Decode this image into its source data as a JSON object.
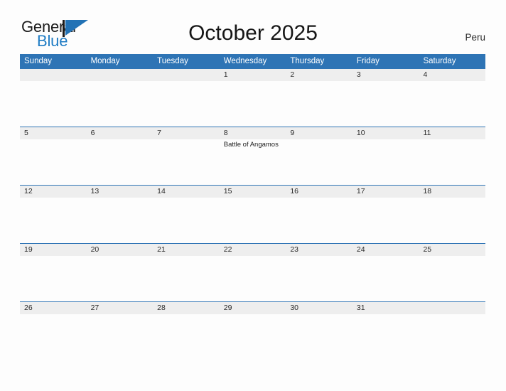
{
  "brand": {
    "name_part1": "General",
    "name_part2": "Blue",
    "triangle_color": "#2272b5",
    "blue_text_color": "#1f7cc4"
  },
  "header": {
    "title": "October 2025",
    "region": "Peru"
  },
  "colors": {
    "header_blue": "#2e74b5",
    "daynum_band": "#eeeeee",
    "page_background": "#fdfdfd",
    "text_dark": "#1b1b1b"
  },
  "calendar": {
    "month": "October",
    "year": "2025",
    "weekday_headers": [
      "Sunday",
      "Monday",
      "Tuesday",
      "Wednesday",
      "Thursday",
      "Friday",
      "Saturday"
    ],
    "weeks": [
      {
        "days": [
          {
            "num": "",
            "events": []
          },
          {
            "num": "",
            "events": []
          },
          {
            "num": "",
            "events": []
          },
          {
            "num": "1",
            "events": []
          },
          {
            "num": "2",
            "events": []
          },
          {
            "num": "3",
            "events": []
          },
          {
            "num": "4",
            "events": []
          }
        ]
      },
      {
        "days": [
          {
            "num": "5",
            "events": []
          },
          {
            "num": "6",
            "events": []
          },
          {
            "num": "7",
            "events": []
          },
          {
            "num": "8",
            "events": [
              "Battle of Angamos"
            ]
          },
          {
            "num": "9",
            "events": []
          },
          {
            "num": "10",
            "events": []
          },
          {
            "num": "11",
            "events": []
          }
        ]
      },
      {
        "days": [
          {
            "num": "12",
            "events": []
          },
          {
            "num": "13",
            "events": []
          },
          {
            "num": "14",
            "events": []
          },
          {
            "num": "15",
            "events": []
          },
          {
            "num": "16",
            "events": []
          },
          {
            "num": "17",
            "events": []
          },
          {
            "num": "18",
            "events": []
          }
        ]
      },
      {
        "days": [
          {
            "num": "19",
            "events": []
          },
          {
            "num": "20",
            "events": []
          },
          {
            "num": "21",
            "events": []
          },
          {
            "num": "22",
            "events": []
          },
          {
            "num": "23",
            "events": []
          },
          {
            "num": "24",
            "events": []
          },
          {
            "num": "25",
            "events": []
          }
        ]
      },
      {
        "days": [
          {
            "num": "26",
            "events": []
          },
          {
            "num": "27",
            "events": []
          },
          {
            "num": "28",
            "events": []
          },
          {
            "num": "29",
            "events": []
          },
          {
            "num": "30",
            "events": []
          },
          {
            "num": "31",
            "events": []
          },
          {
            "num": "",
            "events": []
          }
        ]
      }
    ]
  }
}
